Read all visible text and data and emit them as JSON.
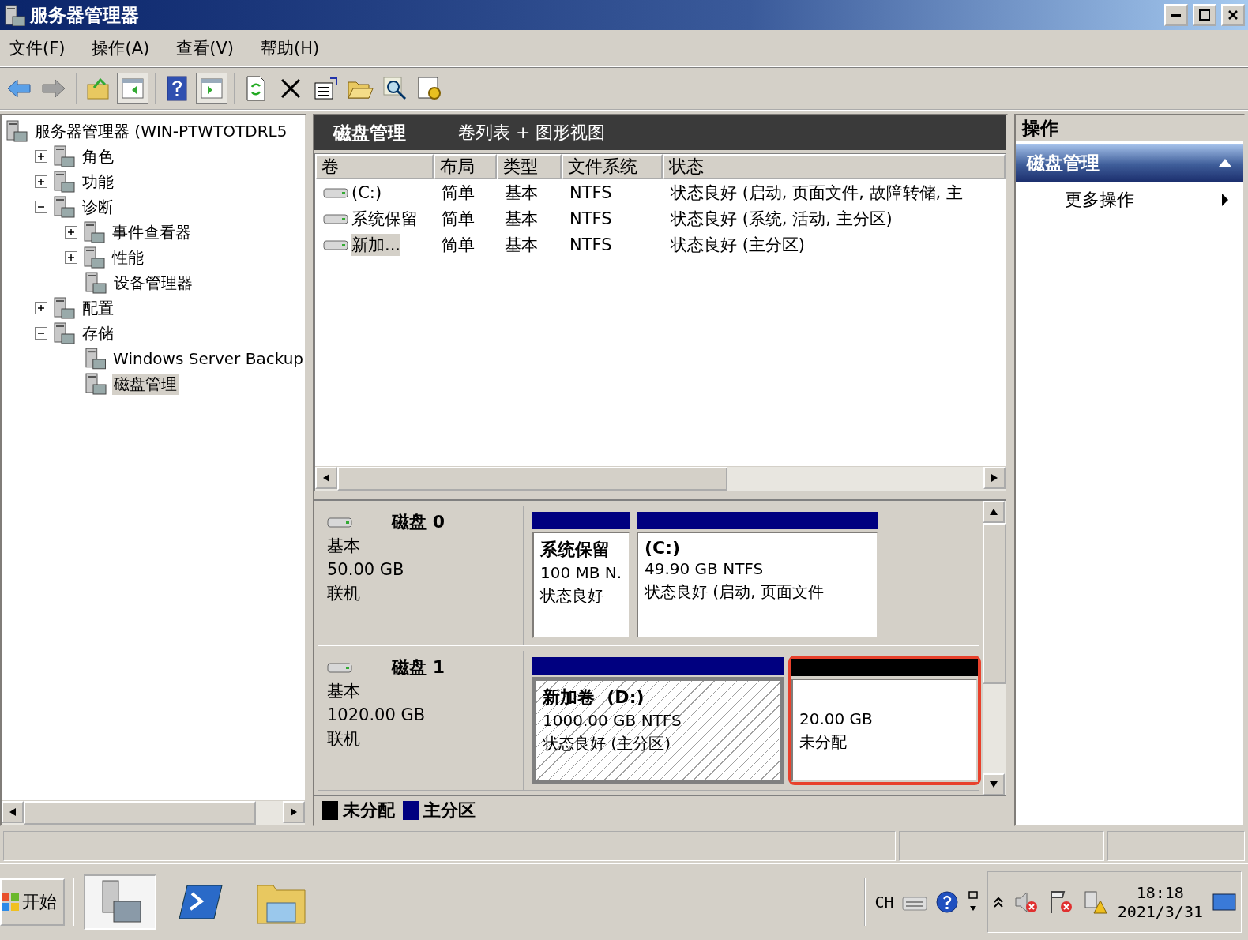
{
  "window": {
    "title": "服务器管理器"
  },
  "menu": [
    "文件(F)",
    "操作(A)",
    "查看(V)",
    "帮助(H)"
  ],
  "toolbar": [
    [
      {
        "kind": "back",
        "pressed": false
      },
      {
        "kind": "forward",
        "pressed": false
      }
    ],
    [
      {
        "kind": "up",
        "pressed": false
      },
      {
        "kind": "pane-left",
        "pressed": true
      }
    ],
    [
      {
        "kind": "help",
        "pressed": false
      },
      {
        "kind": "pane-right",
        "pressed": true
      }
    ],
    [
      {
        "kind": "refresh",
        "pressed": false
      },
      {
        "kind": "delete",
        "pressed": false
      },
      {
        "kind": "properties",
        "pressed": false
      },
      {
        "kind": "open",
        "pressed": false
      },
      {
        "kind": "find",
        "pressed": false
      },
      {
        "kind": "settings",
        "pressed": false
      }
    ]
  ],
  "tree": [
    {
      "label": "服务器管理器 (WIN-PTWTOTDRL5",
      "selected": false,
      "children": [
        {
          "label": "角色",
          "expanded": false,
          "selected": false
        },
        {
          "label": "功能",
          "expanded": false,
          "selected": false
        },
        {
          "label": "诊断",
          "expanded": true,
          "selected": false,
          "children": [
            {
              "label": "事件查看器",
              "expanded": false,
              "selected": false
            },
            {
              "label": "性能",
              "expanded": false,
              "selected": false
            },
            {
              "label": "设备管理器",
              "selected": false
            }
          ]
        },
        {
          "label": "配置",
          "expanded": false,
          "selected": false
        },
        {
          "label": "存储",
          "expanded": true,
          "selected": false,
          "children": [
            {
              "label": "Windows Server Backup",
              "selected": false
            },
            {
              "label": "磁盘管理",
              "selected": true
            }
          ]
        }
      ]
    }
  ],
  "center": {
    "title": "磁盘管理",
    "view": "卷列表 + 图形视图",
    "columns": [
      "卷",
      "布局",
      "类型",
      "文件系统",
      "状态"
    ],
    "rows": [
      {
        "selected": false,
        "cells": [
          "(C:)",
          "简单",
          "基本",
          "NTFS",
          "状态良好 (启动, 页面文件, 故障转储, 主"
        ]
      },
      {
        "selected": false,
        "cells": [
          "系统保留",
          "简单",
          "基本",
          "NTFS",
          "状态良好 (系统, 活动, 主分区)"
        ]
      },
      {
        "selected": true,
        "cells": [
          "新加...",
          "简单",
          "基本",
          "NTFS",
          "状态良好 (主分区)"
        ]
      }
    ],
    "disks": [
      {
        "name": "磁盘 0",
        "type": "基本",
        "size": "50.00 GB",
        "status": "联机",
        "partitions": [
          {
            "kind": "primary",
            "name": "系统保留",
            "detail": "100 MB N.",
            "status": "状态良好",
            "selected": false,
            "highlighted": false
          },
          {
            "kind": "primary",
            "name": "(C:)",
            "detail": "49.90 GB NTFS",
            "status": "状态良好 (启动, 页面文件",
            "selected": false,
            "highlighted": false
          }
        ]
      },
      {
        "name": "磁盘 1",
        "type": "基本",
        "size": "1020.00 GB",
        "status": "联机",
        "partitions": [
          {
            "kind": "primary",
            "name": "新加卷  (D:)",
            "detail": "1000.00 GB NTFS",
            "status": "状态良好 (主分区)",
            "selected": true,
            "highlighted": false
          },
          {
            "kind": "unallocated",
            "detail": "20.00 GB",
            "status": "未分配",
            "selected": false,
            "highlighted": true
          }
        ]
      }
    ],
    "legend": [
      {
        "label": "未分配",
        "color": "#000000"
      },
      {
        "label": "主分区",
        "color": "#000080"
      }
    ]
  },
  "actions": {
    "title": "操作",
    "sections": [
      {
        "title": "磁盘管理",
        "expanded": true,
        "items": [
          "更多操作"
        ]
      }
    ]
  },
  "taskbar": {
    "start": "开始",
    "apps": [
      {
        "kind": "server-manager",
        "active": true
      },
      {
        "kind": "powershell",
        "active": false
      },
      {
        "kind": "explorer",
        "active": false
      }
    ],
    "language": "CH",
    "time": "18:18",
    "date": "2021/3/31"
  }
}
